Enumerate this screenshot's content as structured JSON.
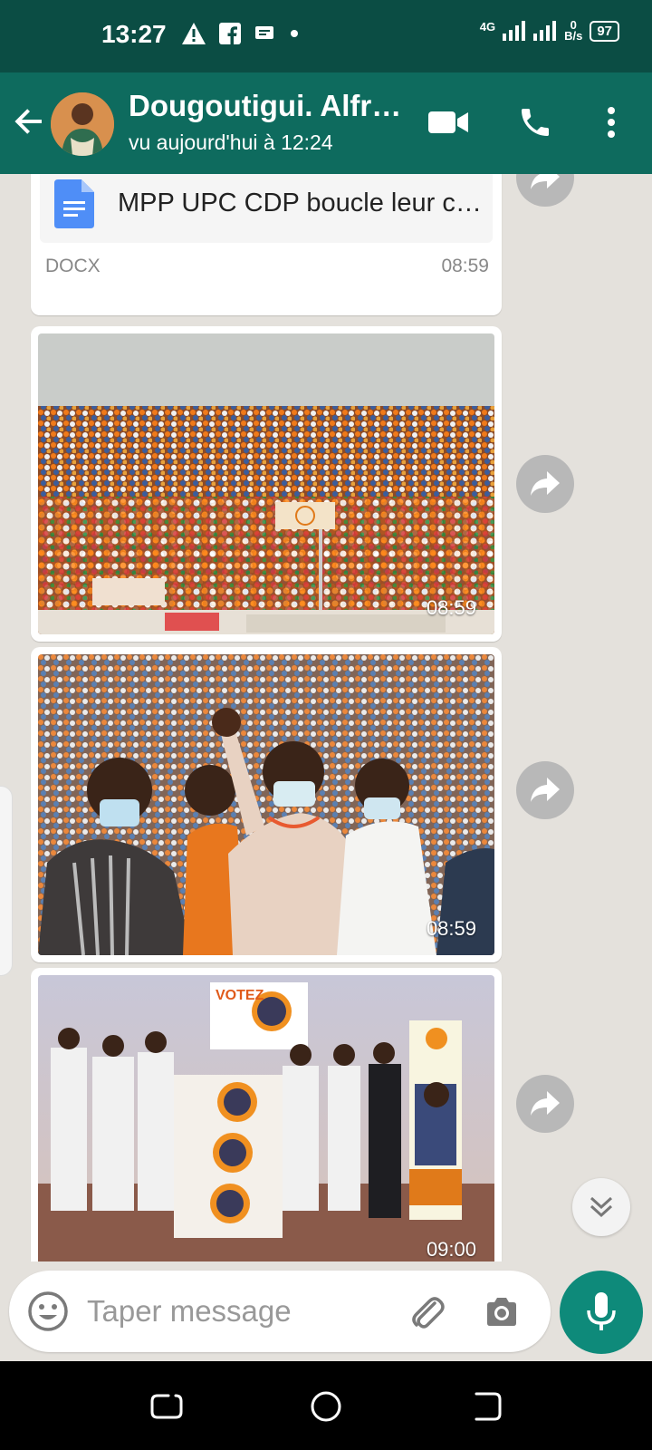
{
  "status": {
    "time": "13:27",
    "network": "4G",
    "net_speed_value": "0",
    "net_speed_unit": "B/s",
    "battery": "97"
  },
  "header": {
    "contact_name": "Dougoutigui. Alfr…",
    "last_seen": "vu aujourd'hui à 12:24"
  },
  "messages": [
    {
      "kind": "document",
      "file_name": "MPP UPC CDP boucle leur c…",
      "file_type": "DOCX",
      "time": "08:59"
    },
    {
      "kind": "image",
      "description_icon": "crowd-stadium-photo",
      "time": "08:59"
    },
    {
      "kind": "image",
      "description_icon": "leader-waving-photo",
      "time": "08:59"
    },
    {
      "kind": "image",
      "description_icon": "campaign-podium-photo",
      "poster_text": "VOTEZ",
      "time": "09:00"
    }
  ],
  "composer": {
    "placeholder": "Taper message"
  },
  "colors": {
    "status_bar": "#0b4d44",
    "app_bar": "#0e6b5e",
    "chat_bg": "#e4e1dc",
    "mic_button": "#0e8a7a"
  }
}
